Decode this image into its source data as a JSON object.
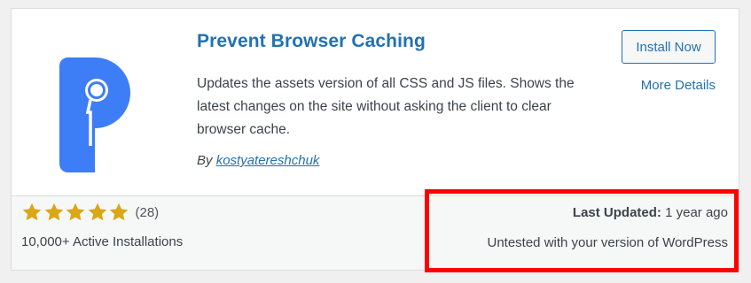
{
  "plugin": {
    "title": "Prevent Browser Caching",
    "description": "Updates the assets version of all CSS and JS files. Shows the latest changes on the site without asking the client to clear browser cache.",
    "author_prefix": "By",
    "author_name": "kostyatereshchuk",
    "install_label": "Install Now",
    "more_details_label": "More Details",
    "logo_icon": "plugin-logo-p-icon"
  },
  "footer": {
    "rating_stars": 5,
    "rating_max": 5,
    "rating_count": "(28)",
    "active_installs": "10,000+ Active Installations",
    "last_updated_label": "Last Updated:",
    "last_updated_value": "1 year ago",
    "compatibility": "Untested with your version of WordPress"
  },
  "colors": {
    "accent": "#2271b1",
    "logo_blue": "#3d7df6",
    "star": "#dba617",
    "highlight": "#ff0000"
  }
}
